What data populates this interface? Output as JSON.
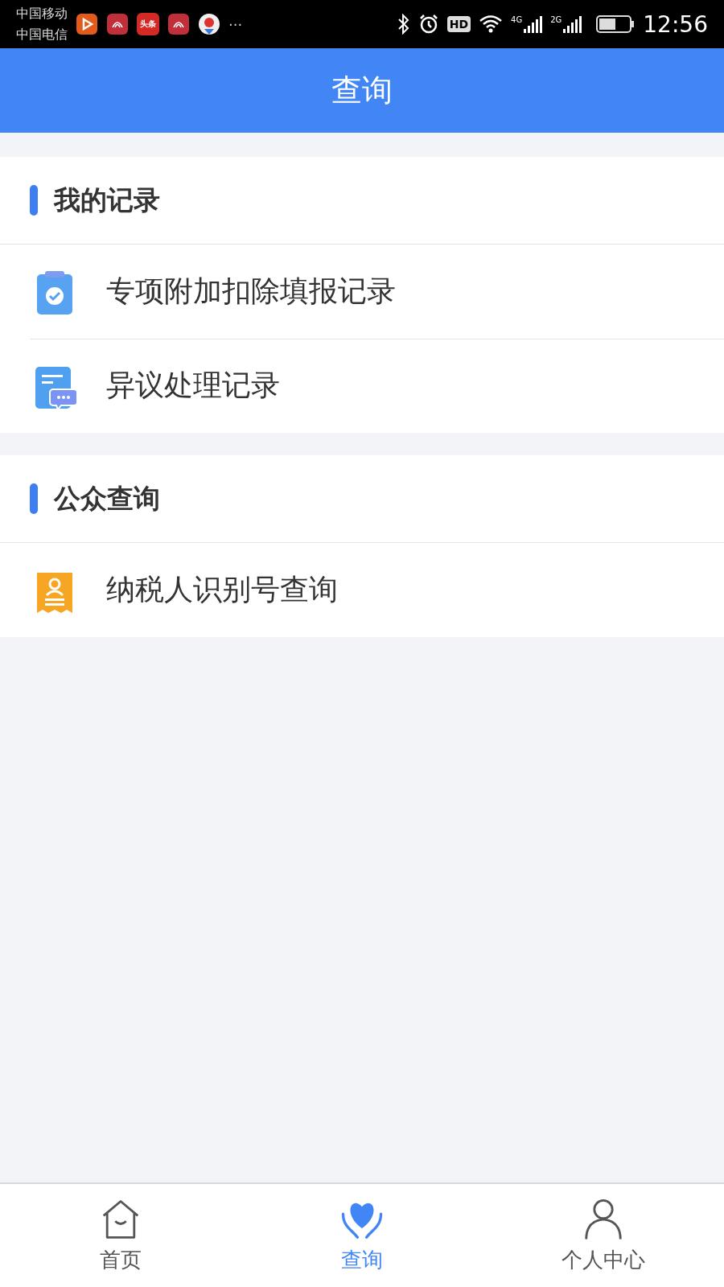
{
  "status_bar": {
    "carriers": [
      "中国移动",
      "中国电信"
    ],
    "notifications": [
      {
        "kind": "video"
      },
      {
        "kind": "app"
      },
      {
        "kind": "news",
        "label": "头条"
      },
      {
        "kind": "app"
      },
      {
        "kind": "map"
      }
    ],
    "more": "···",
    "hd": "HD",
    "signals": [
      "4G",
      "2G"
    ],
    "time": "12:56"
  },
  "header": {
    "title": "查询"
  },
  "sections": [
    {
      "title": "我的记录",
      "items": [
        {
          "label": "专项附加扣除填报记录",
          "kind": "clipboard"
        },
        {
          "label": "异议处理记录",
          "kind": "message"
        }
      ]
    },
    {
      "title": "公众查询",
      "items": [
        {
          "label": "纳税人识别号查询",
          "kind": "person"
        }
      ]
    }
  ],
  "tab_bar": [
    {
      "label": "首页",
      "kind": "home",
      "selected": false
    },
    {
      "label": "查询",
      "kind": "heart",
      "selected": true
    },
    {
      "label": "个人中心",
      "kind": "user",
      "selected": false
    }
  ]
}
